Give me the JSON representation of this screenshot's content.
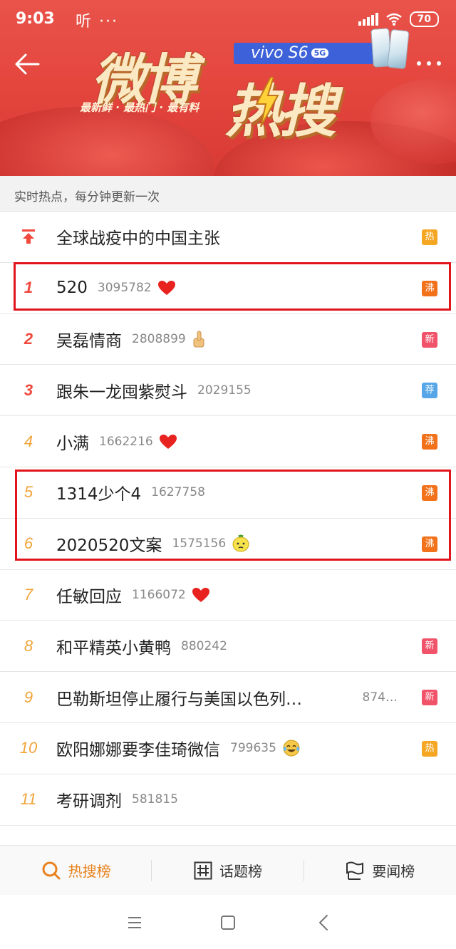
{
  "status_bar": {
    "time": "9:03",
    "extra": "听 ···",
    "battery": "70"
  },
  "banner": {
    "title_line1": "微博",
    "title_line2": "热搜",
    "slogan": "最新鲜 · 最热门 · 最有料",
    "ad_brand": "vivo S6",
    "ad_badge": "5G"
  },
  "subtitle": "实时热点，每分钟更新一次",
  "pinned": {
    "title": "全球战疫中的中国主张",
    "tag": "热"
  },
  "items": [
    {
      "rank": "1",
      "title": "520",
      "count": "3095782",
      "emoji": "heart",
      "tag": "沸",
      "tag_type": "boil"
    },
    {
      "rank": "2",
      "title": "吴磊情商",
      "count": "2808899",
      "emoji": "thumbs-up",
      "tag": "新",
      "tag_type": "new"
    },
    {
      "rank": "3",
      "title": "跟朱一龙囤紫熨斗",
      "count": "2029155",
      "emoji": "",
      "tag": "荐",
      "tag_type": "rec"
    },
    {
      "rank": "4",
      "title": "小满",
      "count": "1662216",
      "emoji": "heart",
      "tag": "沸",
      "tag_type": "boil"
    },
    {
      "rank": "5",
      "title": "1314少个4",
      "count": "1627758",
      "emoji": "",
      "tag": "沸",
      "tag_type": "boil"
    },
    {
      "rank": "6",
      "title": "2020520文案",
      "count": "1575156",
      "emoji": "lemon-face",
      "tag": "沸",
      "tag_type": "boil"
    },
    {
      "rank": "7",
      "title": "任敏回应",
      "count": "1166072",
      "emoji": "heart",
      "tag": "",
      "tag_type": ""
    },
    {
      "rank": "8",
      "title": "和平精英小黄鸭",
      "count": "880242",
      "emoji": "",
      "tag": "新",
      "tag_type": "new"
    },
    {
      "rank": "9",
      "title": "巴勒斯坦停止履行与美国以色列…",
      "count": "874…",
      "emoji": "",
      "tag": "新",
      "tag_type": "new"
    },
    {
      "rank": "10",
      "title": "欧阳娜娜要李佳琦微信",
      "count": "799635",
      "emoji": "laugh-cry",
      "tag": "热",
      "tag_type": "hot"
    },
    {
      "rank": "11",
      "title": "考研调剂",
      "count": "581815",
      "emoji": "",
      "tag": "",
      "tag_type": ""
    }
  ],
  "tabs": [
    {
      "label": "热搜榜",
      "icon": "search-q-icon",
      "active": true
    },
    {
      "label": "话题榜",
      "icon": "hash-icon",
      "active": false
    },
    {
      "label": "要闻榜",
      "icon": "flag-icon",
      "active": false
    }
  ],
  "colors": {
    "accent": "#e8821e",
    "highlight_box": "#e1141c",
    "banner_red": "#e5473f"
  }
}
